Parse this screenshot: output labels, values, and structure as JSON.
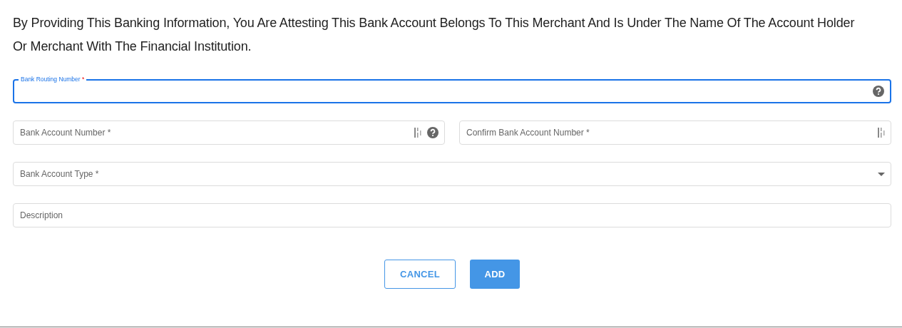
{
  "notice": "By Providing This Banking Information, You Are Attesting This Bank Account Belongs To This Merchant And Is Under The Name Of The Account Holder Or Merchant With The Financial Institution.",
  "rows": [
    {
      "fields": [
        {
          "kind": "text",
          "label": "Bank Routing Number",
          "required_mark": "*",
          "focused": true,
          "icons": [
            {
              "kind": "help"
            }
          ]
        }
      ]
    },
    {
      "fields": [
        {
          "kind": "text",
          "label": "Bank Account Number",
          "required_mark": "*",
          "focused": false,
          "icons": [
            {
              "kind": "bars"
            },
            {
              "kind": "help"
            }
          ]
        },
        {
          "kind": "text",
          "label": "Confirm Bank Account Number",
          "required_mark": "*",
          "focused": false,
          "icons": [
            {
              "kind": "bars"
            }
          ]
        }
      ]
    },
    {
      "fields": [
        {
          "kind": "select",
          "label": "Bank Account Type",
          "required_mark": "*",
          "focused": false
        }
      ]
    },
    {
      "fields": [
        {
          "kind": "text",
          "label": "Description",
          "focused": false
        }
      ]
    }
  ],
  "buttons": [
    {
      "kind": "outline",
      "label": "CANCEL"
    },
    {
      "kind": "filled",
      "label": "ADD"
    }
  ]
}
